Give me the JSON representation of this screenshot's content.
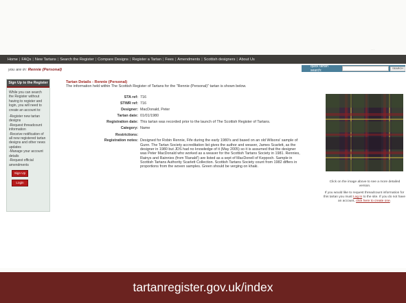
{
  "site": {
    "brand_small": "...",
    "nav": [
      "Home",
      "FAQs",
      "New Tartans",
      "Search the Register",
      "Compare Designs",
      "Register a Tartan",
      "Fees",
      "Amendments",
      "Scottish designers",
      "About Us"
    ]
  },
  "breadcrumb": {
    "prefix": "you are in:",
    "current": "Rennie (Personal)"
  },
  "search": {
    "label": "quick tartan search:",
    "placeholder": "",
    "button": "SEARCH"
  },
  "sidebar": {
    "heading": "Sign Up to the Register",
    "intro": "While you can search the Register without having to register and login, you will need to create an account to:",
    "items": [
      "-Register new tartan designs",
      "-Request threadcount information",
      "-Receive notification of all new registered tartan designs and other news updates",
      "-Manage your account details",
      "-Request official amendments"
    ],
    "signup_label": "Sign Up",
    "login_label": "Login"
  },
  "detail": {
    "title": "Tartan Details - Rennie (Personal)",
    "subtitle": "The information held within The Scottish Register of Tartans for the \"Rennie (Personal)\" tartan is shown below.",
    "rows": [
      {
        "label": "STA ref:",
        "value": "716"
      },
      {
        "label": "STWR ref:",
        "value": "716"
      },
      {
        "label": "Designer:",
        "value": "MacDonald, Peter"
      },
      {
        "label": "Tartan date:",
        "value": "01/01/1980"
      },
      {
        "label": "Registration date:",
        "value": "This tartan was recorded prior to the launch of The Scottish Register of Tartans."
      },
      {
        "label": "Category:",
        "value": "Name"
      },
      {
        "label": "Restrictions:",
        "value": ""
      },
      {
        "label": "Registration notes:",
        "value": "Designed for Robin Rennie, Fife during the early 1980's and based on an old Wilsons' sample of Gunn. The Tartan Society accreditation list gives the author and weaver, James Scarlett, as the designer in 1980 but JDS had no knowledge of it (May 2005) so it is assumed that the designer was Peter MacDonald who worked as a weaver for the Scottish Tartans Society in 1981. Rennies, Rainys and Rainnies (from 'Ranald') are listed as a sept of MacDonell of Keppoch. Sample in Scottish Tartans Authority Scarlett Collection. Scottish Tartans Society count from 1982 differs in proportions from the woven samples. Green should be verging on khaki."
      }
    ]
  },
  "swatch": {
    "caption": "Click on the image above to see a more detailed version.",
    "request_text_1": "If you would like to request threadcount information for this tartan you must",
    "login_link": "Log in",
    "request_text_2": "to the site. If you do not have an account,",
    "create_link": "click here to create one",
    "request_text_3": ".",
    "colors": {
      "base": "#3a2a3c",
      "green": "#3b4a2c",
      "red": "#8a1f24",
      "yellow": "#c9b33a",
      "dark": "#231a26"
    }
  },
  "banner": {
    "url": "tartanregister.gov.uk/index"
  }
}
